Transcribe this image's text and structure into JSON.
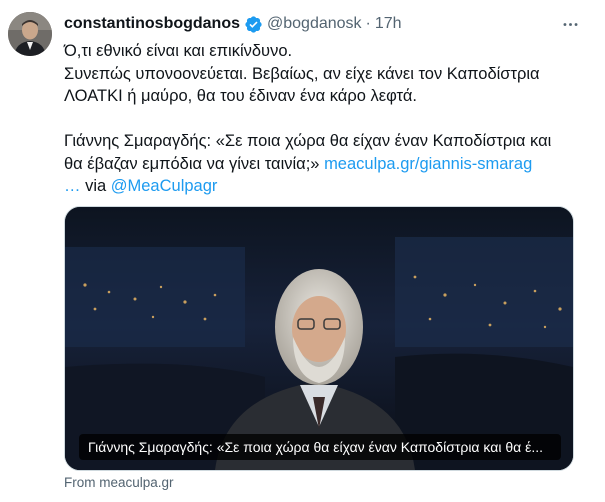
{
  "tweet": {
    "display_name": "constantinosbogdanos",
    "handle": "@bogdanosk",
    "separator": "·",
    "time": "17h",
    "lines": {
      "l1": "Ό,τι εθνικό είναι και επικίνδυνο.",
      "l2": "Συνεπώς υπονοονεύεται. Βεβαίως, αν είχε κάνει τον Καποδίστρια",
      "l3": "ΛΟΑΤΚΙ ή μαύρο, θα του έδιναν ένα κάρο λεφτά.",
      "l5": "Γιάννης Σμαραγδής: «Σε ποια χώρα θα είχαν έναν Καποδίστρια και",
      "l6_text": "θα έβαζαν εμπόδια να γίνει ταινία;» ",
      "l6_link": "meaculpa.gr/giannis-smarag",
      "l7_link": "…",
      "l7_via": " via ",
      "l7_mention": "@MeaCulpagr"
    },
    "media_caption": "Γιάννης Σμαραγδής: «Σε ποια χώρα θα είχαν έναν Καποδίστρια και θα έ...",
    "card_source": "From meaculpa.gr",
    "colors": {
      "link": "#1d9bf0",
      "verified": "#1d9bf0",
      "secondary_text": "#536471"
    },
    "icons": {
      "verified": "verified-badge-icon",
      "more": "more-icon"
    }
  }
}
